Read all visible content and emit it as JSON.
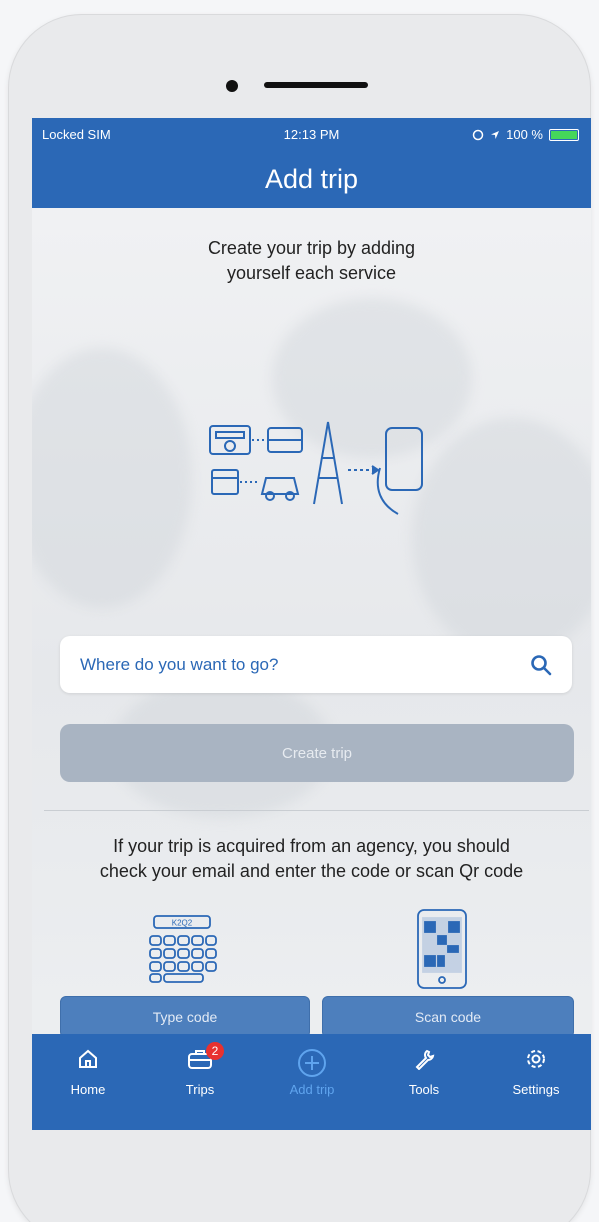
{
  "status_bar": {
    "carrier": "Locked SIM",
    "time": "12:13 PM",
    "battery": "100 %"
  },
  "header": {
    "title": "Add trip"
  },
  "intro": {
    "line1": "Create your trip by adding",
    "line2": "yourself each service"
  },
  "search": {
    "placeholder": "Where do you want to go?"
  },
  "create_button": {
    "label": "Create trip"
  },
  "agency_info": {
    "line1": "If your trip is acquired from an agency, you should",
    "line2": "check your email and enter the code or scan Qr code",
    "keyboard_code": "K2Q2"
  },
  "code_buttons": {
    "type_label": "Type code",
    "scan_label": "Scan code"
  },
  "tabbar": {
    "items": [
      {
        "label": "Home",
        "icon": "home-icon"
      },
      {
        "label": "Trips",
        "icon": "briefcase-icon",
        "badge": "2"
      },
      {
        "label": "Add trip",
        "icon": "plus-circle-icon",
        "active": true
      },
      {
        "label": "Tools",
        "icon": "wrench-icon"
      },
      {
        "label": "Settings",
        "icon": "gear-icon"
      }
    ]
  },
  "colors": {
    "primary": "#2b68b6",
    "disabled": "#a9b4c2",
    "badge": "#e8312f",
    "active_tab": "#5fa4ee"
  }
}
